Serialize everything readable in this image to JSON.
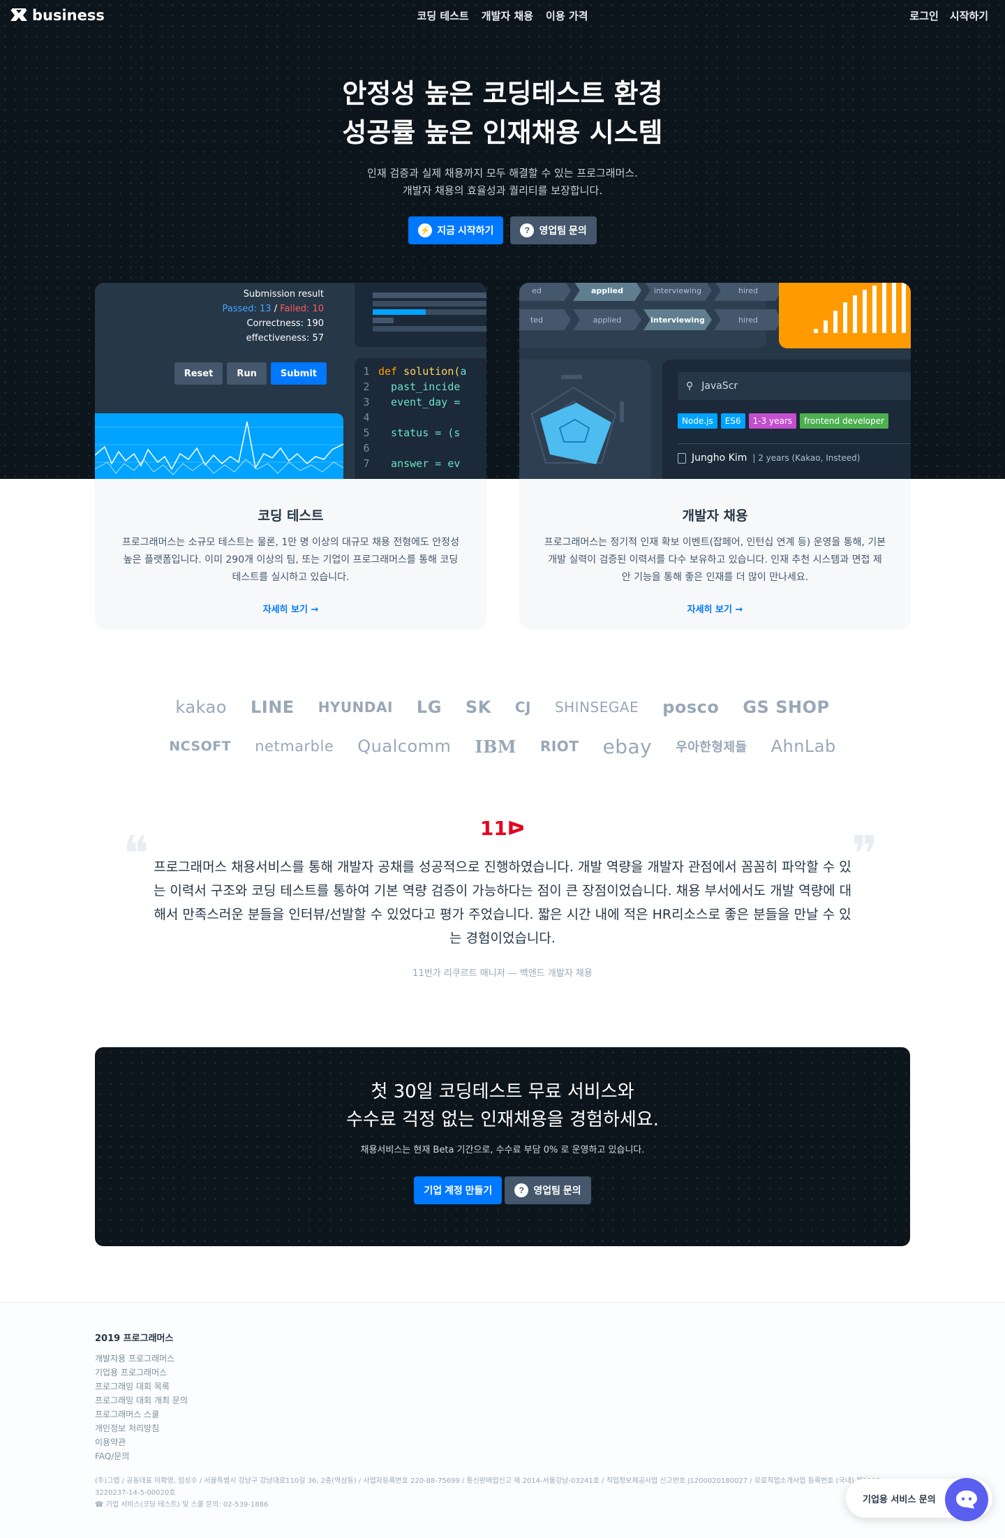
{
  "nav": {
    "brand": "business",
    "center": [
      "코딩 테스트",
      "개발자 채용",
      "이용 가격"
    ],
    "login": "로그인",
    "start": "시작하기"
  },
  "hero": {
    "title_line1": "안정성 높은 코딩테스트 환경",
    "title_line2": "성공률 높은 인재채용 시스템",
    "sub_line1": "인재 검증과 실제 채용까지 모두 해결할 수 있는 프로그래머스.",
    "sub_line2": "개발자 채용의 효율성과 퀄리티를 보장합니다.",
    "btn_start": "지금 시작하기",
    "btn_sales": "영업팀 문의"
  },
  "coding_card": {
    "result_title": "Submission result",
    "passed": "Passed: 13",
    "slash": "/",
    "failed": "Failed: 10",
    "correctness": "Correctness: 190",
    "effectiveness": "effectiveness: 57",
    "btn_reset": "Reset",
    "btn_run": "Run",
    "btn_submit": "Submit",
    "code": [
      {
        "n": "1",
        "a": "def ",
        "b": "solution(",
        "c": "a"
      },
      {
        "n": "2",
        "a": "",
        "b": "",
        "c": "  past_incide"
      },
      {
        "n": "3",
        "a": "",
        "b": "",
        "c": "  event_day ="
      },
      {
        "n": "4",
        "a": "",
        "b": "",
        "c": ""
      },
      {
        "n": "5",
        "a": "",
        "b": "",
        "c": "  status = (s"
      },
      {
        "n": "6",
        "a": "",
        "b": "",
        "c": ""
      },
      {
        "n": "7",
        "a": "",
        "b": "",
        "c": "  answer = ev"
      }
    ],
    "title": "코딩 테스트",
    "desc": "프로그래머스는 소규모 테스트는 물론, 1만 명 이상의 대규모 채용 전형에도 안정성 높은 플랫폼입니다. 이미 290개 이상의 팀, 또는 기업이 프로그래머스를 통해 코딩테스트를 실시하고 있습니다.",
    "more": "자세히 보기 →"
  },
  "hiring_card": {
    "stages_row1": [
      "ed",
      "applied",
      "interviewing",
      "hired"
    ],
    "stages_row2": [
      "ted",
      "applied",
      "interviewing",
      "hired"
    ],
    "search_value": "JavaScr",
    "tags": [
      {
        "label": "Node.js",
        "color": "#00a3ff"
      },
      {
        "label": "ES6",
        "color": "#00a3ff"
      },
      {
        "label": "1-3 years",
        "color": "#c34fcf"
      },
      {
        "label": "frontend developer",
        "color": "#4caf50"
      }
    ],
    "candidate_name": "Jungho Kim",
    "candidate_meta": "| 2 years (Kakao, Insteed)",
    "title": "개발자 채용",
    "desc": "프로그래머스는 정기적 인재 확보 이벤트(잡페어, 인턴십 연계 등) 운영을 통해, 기본 개발 실력이 검증된 이력서를 다수 보유하고 있습니다. 인재 추천 시스템과 면접 제안 기능을 통해 좋은 인재를 더 많이 만나세요.",
    "more": "자세히 보기 →"
  },
  "logos": {
    "row1": [
      "kakao",
      "LINE",
      "HYUNDAI",
      "LG",
      "SK",
      "CJ",
      "SHINSEGAE",
      "posco",
      "GS SHOP"
    ],
    "row2": [
      "NCSOFT",
      "netmarble",
      "Qualcomm",
      "IBM",
      "RIOT",
      "ebay",
      "우아한형제들",
      "AhnLab"
    ]
  },
  "testimonial": {
    "company": "11ᐅ",
    "quote": "프로그래머스 채용서비스를 통해 개발자 공채를 성공적으로 진행하였습니다. 개발 역량을 개발자 관점에서 꼼꼼히 파악할 수 있는 이력서 구조와 코딩 테스트를 통하여 기본 역량 검증이 가능하다는 점이 큰 장점이었습니다. 채용 부서에서도 개발 역량에 대해서 만족스러운 분들을 인터뷰/선발할 수 있었다고 평가 주었습니다. 짧은 시간 내에 적은 HR리소스로 좋은 분들을 만날 수 있는 경험이었습니다.",
    "author": "11번가 리쿠르트 매니저 — 백엔드 개발자 채용"
  },
  "cta": {
    "line1": "첫 30일 코딩테스트 무료 서비스와",
    "line2": "수수료 걱정 없는 인재채용을 경험하세요.",
    "sub": "채용서비스는 현재 Beta 기간으로, 수수료 부담 0% 로 운영하고 있습니다.",
    "btn_create": "기업 계정 만들기",
    "btn_sales": "영업팀 문의"
  },
  "footer": {
    "title": "2019 프로그래머스",
    "links": [
      "개발자용 프로그래머스",
      "기업용 프로그래머스",
      "프로그래밍 대회 목록",
      "프로그래밍 대회 개최 문의",
      "프로그래머스 스쿨",
      "개인정보 처리방침",
      "이용약관",
      "FAQ/문의"
    ],
    "info_line1": "(주)그렙 / 공동대표 이확영, 임성수 / 서울특별시 강남구 강남대로110길 36, 2층(역삼동) / 사업자등록번호 220-88-75699 / 통신판매업신고 제 2014-서울강남-03241호 / 직업정보제공사업 신고번호 J1200020180027 / 유료직업소개사업 등록번호 (국내) 제2019-",
    "info_line2": "3220237-14-5-00020호",
    "info_line3": "☎ 기업 서비스(코딩 테스트) 및 스쿨 문의: 02-539-1886"
  },
  "chat": {
    "label": "기업용 서비스 문의"
  },
  "colors": {
    "accent": "#0078ff",
    "dark": "#0c151c",
    "orange": "#ff9a00"
  }
}
